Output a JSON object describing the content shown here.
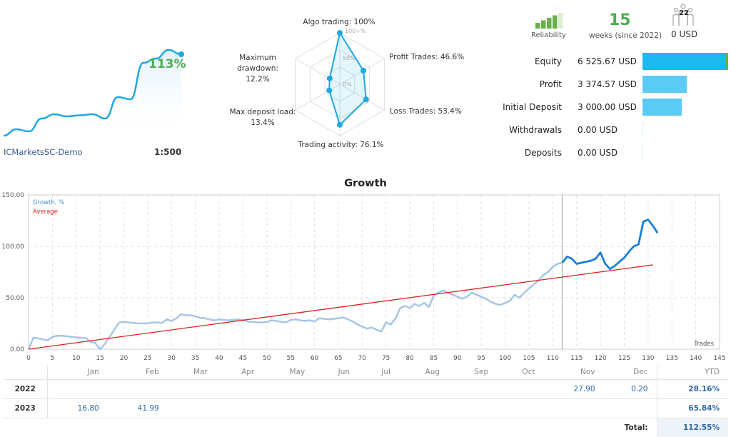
{
  "summary": {
    "growth_pct": "113%",
    "broker": "ICMarketsSC-Demo",
    "leverage": "1:500",
    "mini_curve": [
      0,
      3,
      2,
      8,
      10,
      9,
      9.5,
      10,
      8,
      18,
      17,
      34,
      36,
      40,
      38
    ]
  },
  "radar": {
    "axes": [
      {
        "label": "Algo trading: 100%",
        "value": 100
      },
      {
        "label": "Profit Trades: 46.6%",
        "value": 46.6
      },
      {
        "label": "Loss Trades: 53.4%",
        "value": 53.4
      },
      {
        "label": "Trading activity: 76.1%",
        "value": 76.1
      },
      {
        "label": "Max deposit load:\n13.4%",
        "value": 13.4
      },
      {
        "label": "Maximum drawdown:\n12.2%",
        "value": 12.2
      }
    ],
    "scale_labels": [
      "100+%",
      "50%",
      "0%"
    ]
  },
  "stats": {
    "reliability_label": "Reliability",
    "reliability_bars": 4,
    "reliability_total": 5,
    "weeks": "15",
    "weeks_label": "weeks (since 2022)",
    "subscribers": "22",
    "subscribers_usd": "0 USD"
  },
  "financials": [
    {
      "label": "Equity",
      "value": "6 525.67 USD",
      "fraction": 1.0,
      "color": "#1eb7ef"
    },
    {
      "label": "Profit",
      "value": "3 374.57 USD",
      "fraction": 0.517,
      "color": "#5ccbf3"
    },
    {
      "label": "Initial Deposit",
      "value": "3 000.00 USD",
      "fraction": 0.46,
      "color": "#5ccbf3"
    },
    {
      "label": "Withdrawals",
      "value": "0.00 USD",
      "fraction": 0,
      "color": "#5ccbf3"
    },
    {
      "label": "Deposits",
      "value": "0.00 USD",
      "fraction": 0,
      "color": "#5ccbf3"
    }
  ],
  "growth_title": "Growth",
  "chart_data": {
    "type": "line",
    "title": "Growth",
    "xlabel": "Trades",
    "ylabel": "",
    "xlim": [
      0,
      145
    ],
    "ylim": [
      0,
      150
    ],
    "xticks": [
      0,
      5,
      10,
      15,
      20,
      25,
      30,
      35,
      40,
      45,
      50,
      55,
      60,
      65,
      70,
      75,
      80,
      85,
      90,
      95,
      100,
      105,
      110,
      115,
      120,
      125,
      130,
      135,
      140,
      145
    ],
    "yticks": [
      "0.00",
      "50.00",
      "100.00",
      "150.00"
    ],
    "legend": [
      "Growth, %",
      "Average"
    ],
    "legend_placement": "top-left",
    "highlight_from_trade": 112,
    "series": [
      {
        "name": "Growth, %",
        "values": [
          0,
          11,
          10.5,
          9.5,
          8.5,
          12,
          13,
          13,
          12.5,
          12,
          11.5,
          11,
          11,
          7,
          6,
          0,
          5,
          12,
          19,
          26,
          26.5,
          26,
          25.5,
          25,
          25,
          25,
          26,
          26,
          25.5,
          29,
          27.5,
          30,
          34,
          33,
          33,
          32,
          30.5,
          30,
          29,
          28,
          29,
          28.5,
          28,
          28.5,
          29,
          28.5,
          27,
          26.5,
          26,
          26,
          26.5,
          28,
          27.5,
          26.5,
          26,
          28.5,
          29,
          28,
          27.5,
          28,
          27,
          30,
          29.5,
          29,
          29.5,
          30,
          31,
          29,
          27,
          24,
          22,
          20,
          21,
          19,
          17,
          26,
          24,
          30,
          40,
          42,
          40,
          44,
          42,
          45,
          41,
          52,
          55,
          57,
          55,
          53,
          51,
          49,
          51,
          55,
          53,
          51,
          49,
          46,
          44,
          43,
          45,
          47,
          53,
          50,
          55,
          59,
          63,
          67,
          72,
          75,
          80,
          83,
          84,
          90,
          88,
          83,
          84,
          85,
          86,
          88,
          94,
          83,
          78,
          81,
          85,
          89,
          95,
          100,
          102,
          124,
          126,
          120,
          113
        ]
      },
      {
        "name": "Average",
        "values_endpoints": [
          [
            0,
            0
          ],
          [
            131,
            82
          ]
        ]
      }
    ]
  },
  "monthly_table": {
    "headers": [
      "",
      "Jan",
      "Feb",
      "Mar",
      "Apr",
      "May",
      "Jun",
      "Jul",
      "Aug",
      "Sep",
      "Oct",
      "Nov",
      "Dec",
      "YTD"
    ],
    "rows": [
      {
        "year": "2022",
        "months": [
          "",
          "",
          "",
          "",
          "",
          "",
          "",
          "",
          "",
          "",
          "27.90",
          "0.20"
        ],
        "ytd": "28.16%"
      },
      {
        "year": "2023",
        "months": [
          "16.80",
          "41.99",
          "",
          "",
          "",
          "",
          "",
          "",
          "",
          "",
          "",
          ""
        ],
        "ytd": "65.84%"
      }
    ],
    "total_label": "Total:",
    "total_value": "112.55%"
  }
}
